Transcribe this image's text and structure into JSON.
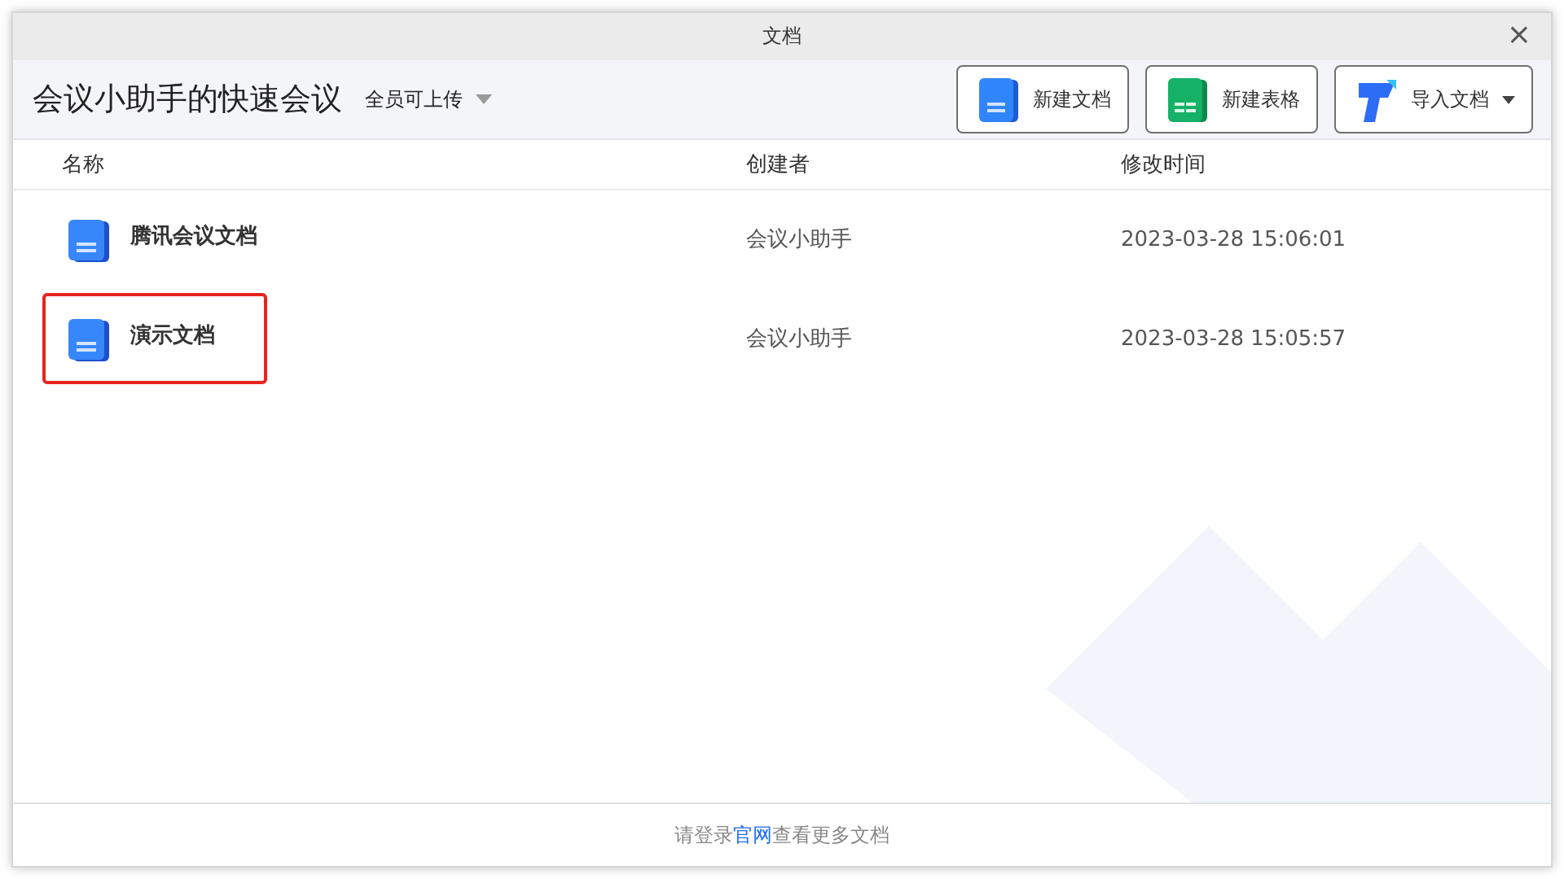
{
  "window": {
    "title": "文档",
    "close": "×"
  },
  "header": {
    "title": "会议小助手的快速会议",
    "permission": "全员可上传",
    "buttons": [
      {
        "kind": "doc",
        "label": "新建文档",
        "dropdown": false
      },
      {
        "kind": "sheet",
        "label": "新建表格",
        "dropdown": false
      },
      {
        "kind": "import",
        "label": "导入文档",
        "dropdown": true
      }
    ]
  },
  "table": {
    "columns": [
      "名称",
      "创建者",
      "修改时间"
    ],
    "rows": [
      {
        "name": "腾讯会议文档",
        "creator": "会议小助手",
        "modified": "2023-03-28 15:06:01",
        "highlighted": false
      },
      {
        "name": "演示文档",
        "creator": "会议小助手",
        "modified": "2023-03-28 15:05:57",
        "highlighted": true
      }
    ]
  },
  "footer": {
    "before": "请登录",
    "link": "官网",
    "after": "查看更多文档"
  }
}
